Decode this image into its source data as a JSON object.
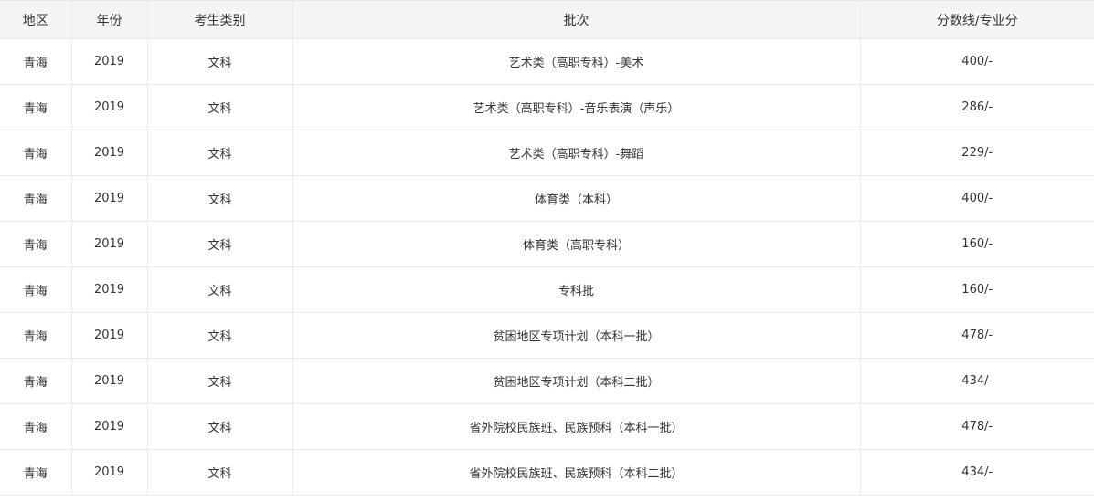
{
  "table": {
    "headers": [
      "地区",
      "年份",
      "考生类别",
      "批次",
      "分数线/专业分"
    ],
    "rows": [
      [
        "青海",
        "2019",
        "文科",
        "艺术类（高职专科）-美术",
        "400/-"
      ],
      [
        "青海",
        "2019",
        "文科",
        "艺术类（高职专科）-音乐表演（声乐）",
        "286/-"
      ],
      [
        "青海",
        "2019",
        "文科",
        "艺术类（高职专科）-舞蹈",
        "229/-"
      ],
      [
        "青海",
        "2019",
        "文科",
        "体育类（本科）",
        "400/-"
      ],
      [
        "青海",
        "2019",
        "文科",
        "体育类（高职专科）",
        "160/-"
      ],
      [
        "青海",
        "2019",
        "文科",
        "专科批",
        "160/-"
      ],
      [
        "青海",
        "2019",
        "文科",
        "贫困地区专项计划（本科一批）",
        "478/-"
      ],
      [
        "青海",
        "2019",
        "文科",
        "贫困地区专项计划（本科二批）",
        "434/-"
      ],
      [
        "青海",
        "2019",
        "文科",
        "省外院校民族班、民族预科（本科一批）",
        "478/-"
      ],
      [
        "青海",
        "2019",
        "文科",
        "省外院校民族班、民族预科（本科二批）",
        "434/-"
      ]
    ]
  }
}
